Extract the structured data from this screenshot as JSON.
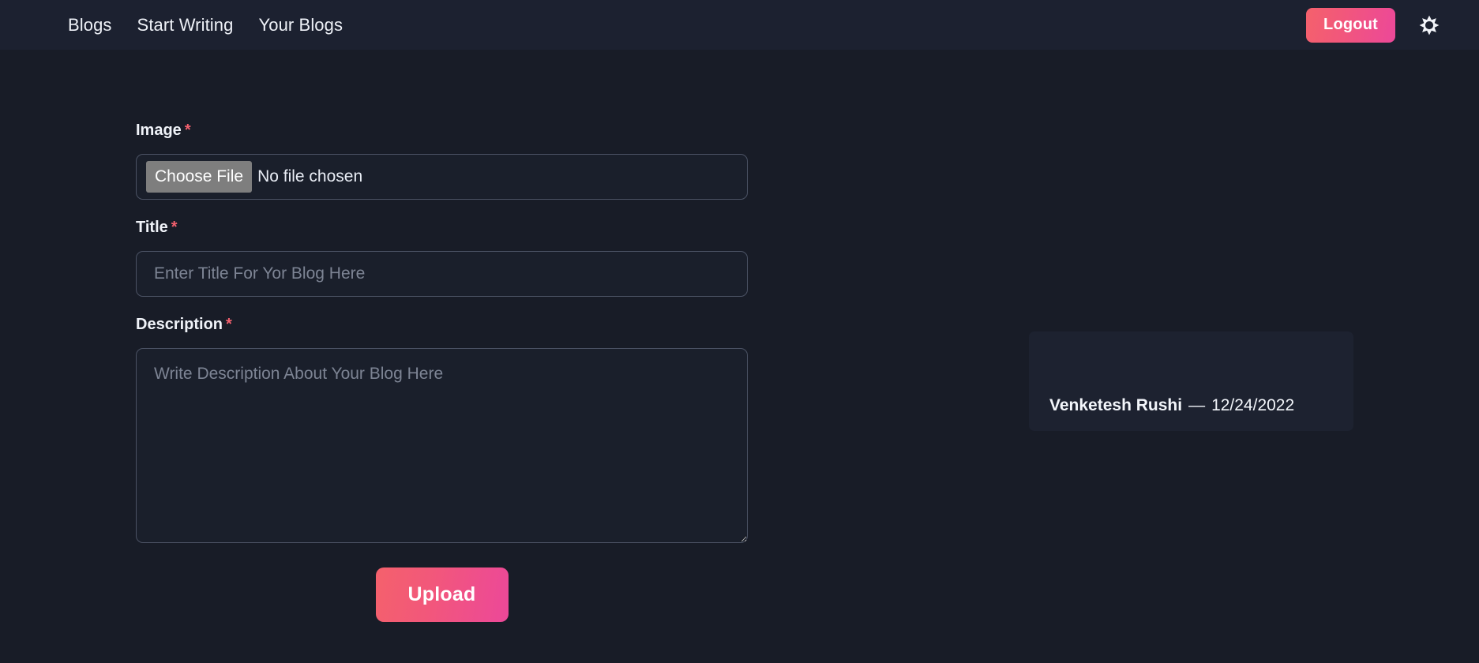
{
  "theme": {
    "page_bg": "#181c27",
    "navbar_bg": "#1c2130",
    "accent_start": "#f4616c",
    "accent_end": "#ec4899",
    "required_star": "#f4606e",
    "card_bg": "#1d2230",
    "input_border": "#4b5264",
    "placeholder": "#7d8494"
  },
  "navbar": {
    "links": [
      {
        "label": "Blogs",
        "name": "nav-link-blogs"
      },
      {
        "label": "Start Writing",
        "name": "nav-link-start-writing"
      },
      {
        "label": "Your Blogs",
        "name": "nav-link-your-blogs"
      }
    ],
    "logout_label": "Logout",
    "theme_toggle_icon": "sun-icon"
  },
  "form": {
    "image": {
      "label": "Image",
      "required_mark": "*",
      "choose_file_label": "Choose File",
      "file_status": "No file chosen",
      "value": ""
    },
    "title": {
      "label": "Title",
      "required_mark": "*",
      "placeholder": "Enter Title For Yor Blog Here",
      "value": ""
    },
    "description": {
      "label": "Description",
      "required_mark": "*",
      "placeholder": "Write Description About Your Blog Here",
      "value": ""
    },
    "submit_label": "Upload"
  },
  "blog_card": {
    "author": "Venketesh Rushi",
    "separator": "—",
    "date": "12/24/2022"
  }
}
